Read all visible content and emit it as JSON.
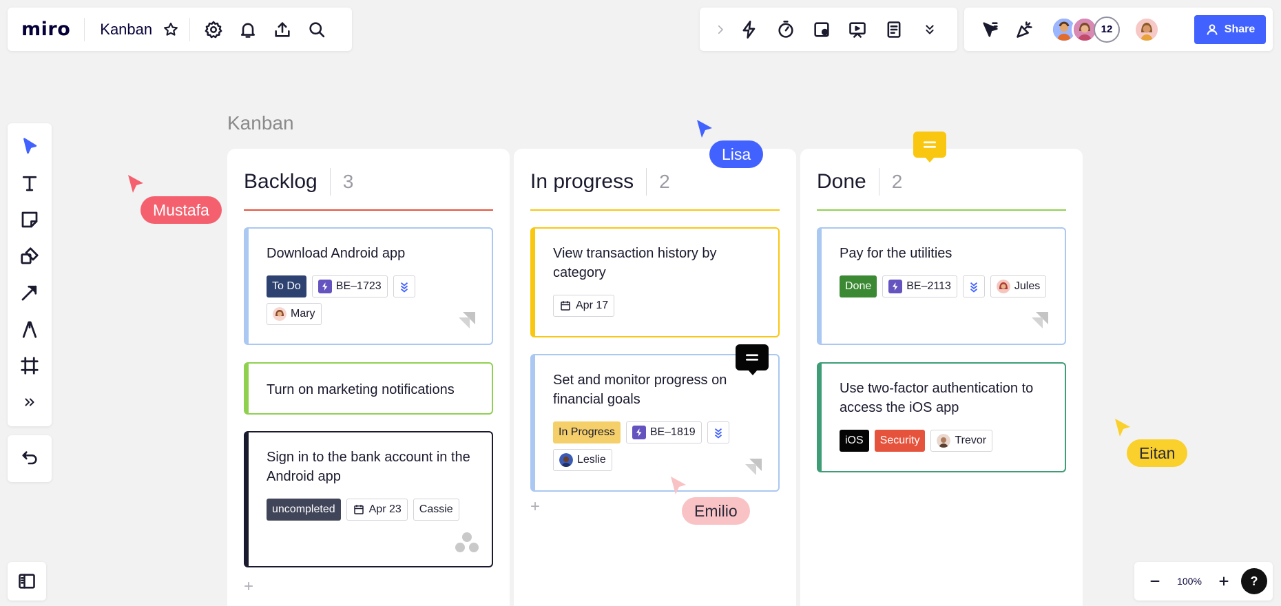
{
  "app": {
    "logo": "miro",
    "board_title": "Kanban"
  },
  "toolbar_right": {
    "share_label": "Share",
    "collaborator_count": "12"
  },
  "zoom": {
    "value": "100%",
    "help_label": "?"
  },
  "board": {
    "frame_label": "Kanban",
    "columns": [
      {
        "title": "Backlog",
        "count": "3",
        "line_color": "#e6533c",
        "cards": [
          {
            "title": "Download Android app",
            "status": "To Do",
            "status_color": "#2d4271",
            "ticket": "BE–1723",
            "assignee": "Mary",
            "border": "#aac8f2"
          },
          {
            "title": "Turn on marketing notifications",
            "border": "#8fd14f"
          },
          {
            "title": "Sign in to the bank account in the Android app",
            "status": "uncompleted",
            "status_color": "#414559",
            "date": "Apr 23",
            "assignee": "Cassie",
            "border": "#1a1a2e"
          }
        ]
      },
      {
        "title": "In progress",
        "count": "2",
        "line_color": "#fac710",
        "cards": [
          {
            "title": "View transaction history by category",
            "date": "Apr 17",
            "border": "#fac710"
          },
          {
            "title": "Set and monitor progress on financial goals",
            "status": "In Progress",
            "status_color": "#f5d06a",
            "ticket": "BE–1819",
            "assignee": "Leslie",
            "border": "#aac8f2"
          }
        ]
      },
      {
        "title": "Done",
        "count": "2",
        "line_color": "#8fd14f",
        "cards": [
          {
            "title": "Pay for the utilities",
            "status": "Done",
            "status_color": "#3b8a33",
            "ticket": "BE–2113",
            "assignee": "Jules",
            "border": "#aac8f2"
          },
          {
            "title": "Use two-factor authentication to access the iOS app",
            "tag1": "iOS",
            "tag2": "Security",
            "assignee": "Trevor",
            "border": "#3e9c77"
          }
        ]
      }
    ]
  },
  "cursors": [
    {
      "name": "Mustafa",
      "color": "#f4606e"
    },
    {
      "name": "Lisa",
      "color": "#4262ff"
    },
    {
      "name": "Emilio",
      "color": "#f9c2c4"
    },
    {
      "name": "Eitan",
      "color": "#fad02c"
    }
  ],
  "colors": {
    "accent": "#4262ff",
    "comment_yellow": "#fac710",
    "comment_black": "#050505"
  }
}
